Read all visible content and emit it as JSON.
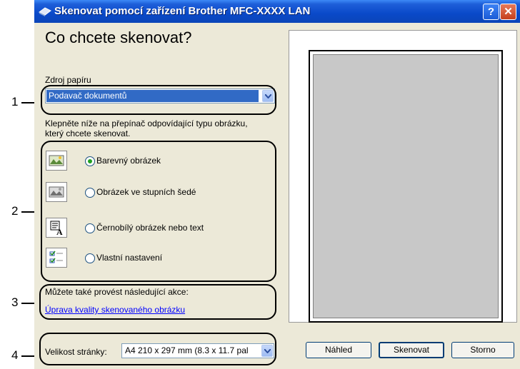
{
  "window": {
    "title": "Skenovat pomocí zařízení Brother MFC-XXXX  LAN",
    "help_label": "?",
    "close_label": "✕"
  },
  "heading": "Co chcete skenovat?",
  "paper_source": {
    "label": "Zdroj papíru",
    "selected": "Podavač dokumentů"
  },
  "instruction_lines": [
    "Klepněte níže na přepínač odpovídající typu obrázku,",
    "který chcete skenovat."
  ],
  "image_types": [
    {
      "label": "Barevný obrázek",
      "selected": true,
      "icon": "color-picture-icon"
    },
    {
      "label": "Obrázek ve stupních šedé",
      "selected": false,
      "icon": "grayscale-picture-icon"
    },
    {
      "label": "Černobílý obrázek nebo text",
      "selected": false,
      "icon": "bw-text-icon"
    },
    {
      "label": "Vlastní nastavení",
      "selected": false,
      "icon": "custom-settings-icon"
    }
  ],
  "actions": {
    "intro": "Můžete také provést následující akce:",
    "link": "Úprava kvality skenovaného obrázku"
  },
  "page_size": {
    "label": "Velikost stránky:",
    "value": "A4 210 x 297 mm (8.3 x 11.7 pal"
  },
  "buttons": {
    "preview": "Náhled",
    "scan": "Skenovat",
    "cancel": "Storno"
  },
  "callouts": [
    "1",
    "2",
    "3",
    "4"
  ],
  "colors": {
    "titlebar": "#0a49c9",
    "dialog_bg": "#ece9d8",
    "selection": "#316ac5",
    "link": "#0000ff"
  }
}
